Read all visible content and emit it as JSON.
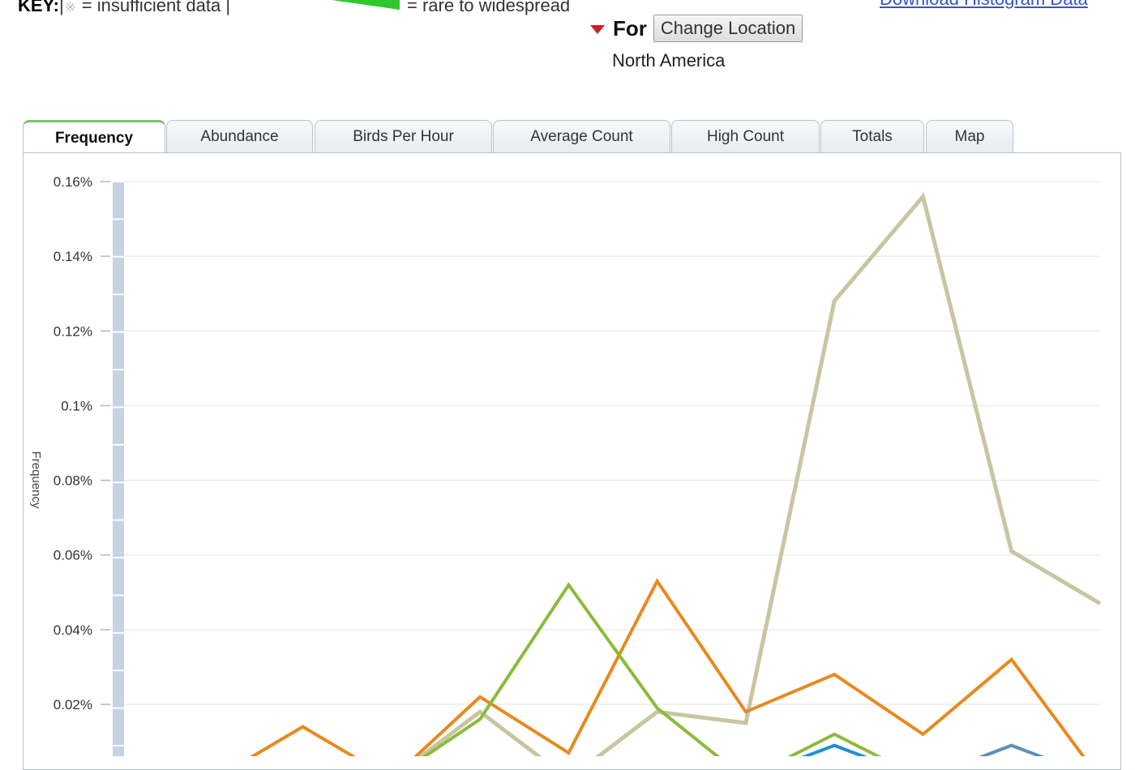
{
  "key": {
    "label": "KEY:",
    "insufficient_symbol": "※",
    "insufficient_text": "= insufficient data |",
    "rare_text": "= rare to widespread"
  },
  "download_link": "Download Histogram Data",
  "location": {
    "for_label": "For",
    "change_button": "Change Location",
    "current": "North America"
  },
  "tabs": [
    {
      "label": "Frequency",
      "active": true
    },
    {
      "label": "Abundance",
      "active": false
    },
    {
      "label": "Birds Per Hour",
      "active": false
    },
    {
      "label": "Average Count",
      "active": false
    },
    {
      "label": "High Count",
      "active": false
    },
    {
      "label": "Totals",
      "active": false
    },
    {
      "label": "Map",
      "active": false
    }
  ],
  "colors": {
    "key_green": "#2ec82e",
    "insufficient_bar": "#c5d3e2",
    "tab_active_accent": "#7cc070"
  },
  "chart_data": {
    "type": "line",
    "title": "",
    "xlabel": "",
    "ylabel": "Frequency",
    "ylim": [
      0,
      0.16
    ],
    "y_ticks": [
      "0.16%",
      "0.14%",
      "0.12%",
      "0.1%",
      "0.08%",
      "0.06%",
      "0.04%",
      "0.02%"
    ],
    "y_tick_values": [
      0.16,
      0.14,
      0.12,
      0.1,
      0.08,
      0.06,
      0.04,
      0.02
    ],
    "grid": true,
    "x": [
      0,
      1,
      2,
      3,
      4,
      5,
      6,
      7,
      8,
      9,
      10,
      11
    ],
    "series": [
      {
        "color": "#c8c6a0",
        "values": [
          0,
          0,
          0,
          0,
          0.018,
          0,
          0.018,
          0.015,
          0.128,
          0.156,
          0.061,
          0.047
        ]
      },
      {
        "color": "#e8891e",
        "values": [
          0,
          0,
          0.014,
          0,
          0.022,
          0.007,
          0.053,
          0.018,
          0.028,
          0.012,
          0.032,
          0
        ]
      },
      {
        "color": "#8bbb3a",
        "values": [
          0,
          0,
          0,
          0,
          0.016,
          0.052,
          0.019,
          0,
          0.012,
          0,
          0,
          0
        ]
      },
      {
        "color": "#1e90d6",
        "values": [
          0,
          0,
          0,
          0,
          0,
          0,
          0,
          0,
          0.009,
          0,
          0,
          0
        ]
      },
      {
        "color": "#5f8fb4",
        "values": [
          0,
          0,
          0,
          0,
          0,
          0,
          0,
          0,
          0,
          0,
          0.009,
          0
        ]
      }
    ]
  }
}
